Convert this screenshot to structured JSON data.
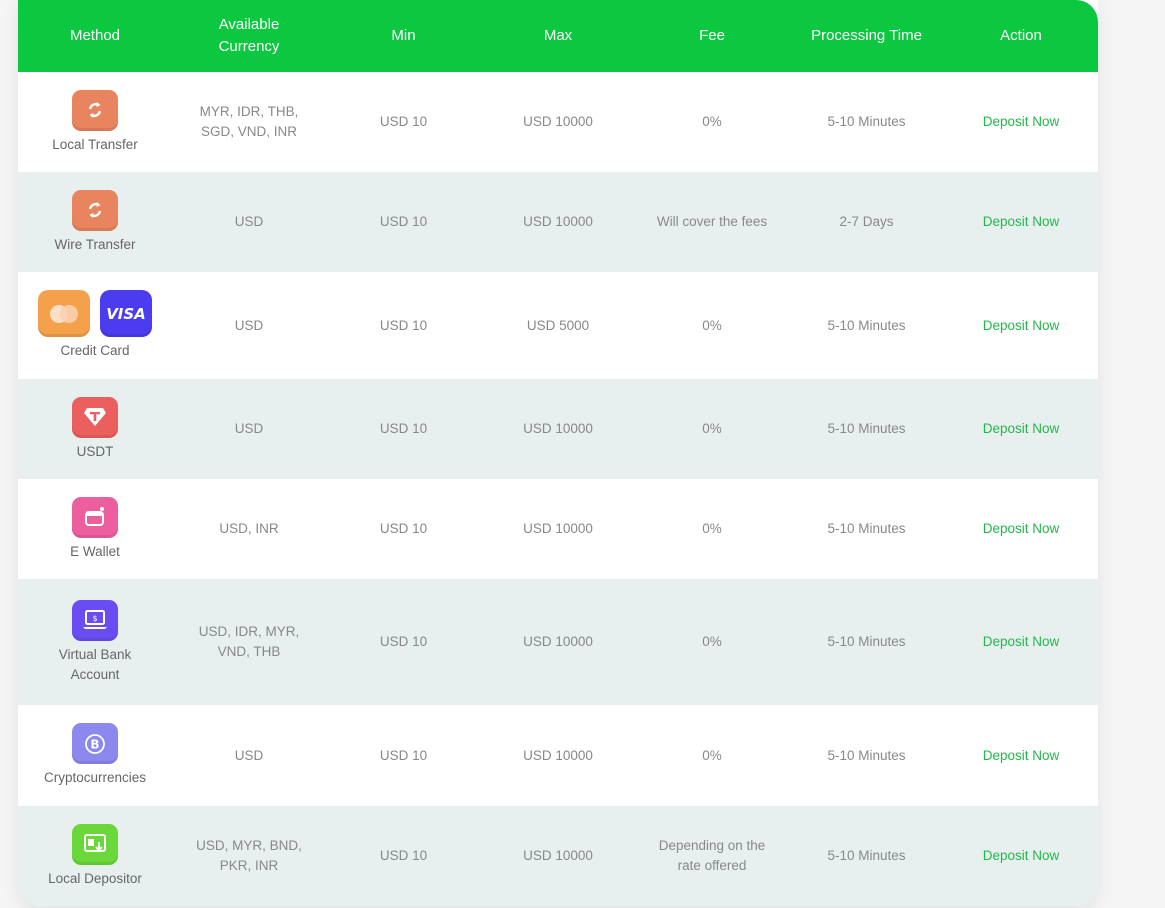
{
  "header": {
    "method": "Method",
    "currency": "Available\nCurrency",
    "min": "Min",
    "max": "Max",
    "fee": "Fee",
    "time": "Processing Time",
    "action": "Action"
  },
  "colors": {
    "header_bg": "#0cc840",
    "action_text": "#22b84a",
    "row_alt": "#e8f0ef"
  },
  "rows": [
    {
      "method": "Local Transfer",
      "icons": [
        {
          "name": "transfer-icon",
          "color": "#e8845e"
        }
      ],
      "currency": "MYR, IDR, THB,\nSGD, VND, INR",
      "min": "USD 10",
      "max": "USD 10000",
      "fee": "0%",
      "time": "5-10 Minutes",
      "action": "Deposit Now"
    },
    {
      "method": "Wire Transfer",
      "icons": [
        {
          "name": "transfer-icon",
          "color": "#e8845e"
        }
      ],
      "currency": "USD",
      "min": "USD 10",
      "max": "USD 10000",
      "fee": "Will cover the fees",
      "time": "2-7 Days",
      "action": "Deposit Now"
    },
    {
      "method": "Credit Card",
      "icons": [
        {
          "name": "mastercard-icon",
          "color": "#f5a04a"
        },
        {
          "name": "visa-icon",
          "color": "#4b3cf0",
          "label": "VISA"
        }
      ],
      "currency": "USD",
      "min": "USD 10",
      "max": "USD 5000",
      "fee": "0%",
      "time": "5-10 Minutes",
      "action": "Deposit Now"
    },
    {
      "method": "USDT",
      "icons": [
        {
          "name": "tether-icon",
          "color": "#ec5f5f"
        }
      ],
      "currency": "USD",
      "min": "USD 10",
      "max": "USD 10000",
      "fee": "0%",
      "time": "5-10 Minutes",
      "action": "Deposit Now"
    },
    {
      "method": "E Wallet",
      "icons": [
        {
          "name": "wallet-icon",
          "color": "#ec5f9f"
        }
      ],
      "currency": "USD, INR",
      "min": "USD 10",
      "max": "USD 10000",
      "fee": "0%",
      "time": "5-10 Minutes",
      "action": "Deposit Now"
    },
    {
      "method": "Virtual Bank\nAccount",
      "icons": [
        {
          "name": "laptop-bank-icon",
          "color": "#6a4cf3"
        }
      ],
      "currency": "USD, IDR, MYR,\nVND, THB",
      "min": "USD 10",
      "max": "USD 10000",
      "fee": "0%",
      "time": "5-10 Minutes",
      "action": "Deposit Now"
    },
    {
      "method": "Cryptocurrencies",
      "icons": [
        {
          "name": "bitcoin-icon",
          "color": "#8c88ee"
        }
      ],
      "currency": "USD",
      "min": "USD 10",
      "max": "USD 10000",
      "fee": "0%",
      "time": "5-10 Minutes",
      "action": "Deposit Now"
    },
    {
      "method": "Local Depositor",
      "icons": [
        {
          "name": "depositor-icon",
          "color": "#6ad83a"
        }
      ],
      "currency": "USD, MYR, BND,\nPKR, INR",
      "min": "USD 10",
      "max": "USD 10000",
      "fee": "Depending on the\nrate offered",
      "time": "5-10 Minutes",
      "action": "Deposit Now"
    }
  ]
}
